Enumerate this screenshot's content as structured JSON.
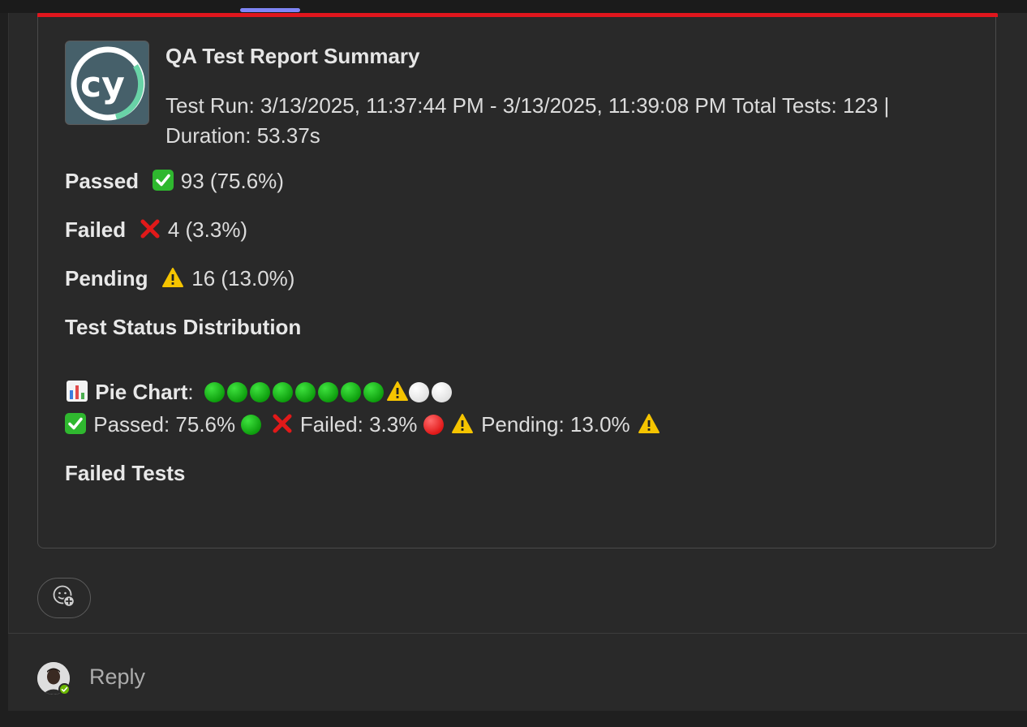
{
  "header": {
    "title": "QA Test Report Summary",
    "subtitle": "Test Run: 3/13/2025, 11:37:44 PM - 3/13/2025, 11:39:08 PM Total Tests: 123 | Duration: 53.37s"
  },
  "stats": {
    "passed": {
      "label": "Passed",
      "value": "93 (75.6%)"
    },
    "failed": {
      "label": "Failed",
      "value": "4 (3.3%)"
    },
    "pending": {
      "label": "Pending",
      "value": "16 (13.0%)"
    }
  },
  "distribution": {
    "heading": "Test Status Distribution",
    "pie_label": "Pie Chart",
    "pie_colon": ":",
    "legend": {
      "passed": "Passed: 75.6%",
      "failed": "Failed: 3.3%",
      "pending": "Pending: 13.0%"
    }
  },
  "failed_tests": {
    "heading": "Failed Tests"
  },
  "reply": {
    "label": "Reply"
  },
  "icons": {
    "logo": "cypress-logo",
    "passed": "check-mark-icon",
    "failed": "cross-mark-icon",
    "pending": "warning-icon",
    "chart": "bar-chart-icon",
    "reaction": "add-reaction-icon",
    "presence": "available-status-icon"
  },
  "colors": {
    "accent": "#e0161d",
    "passed": "#12a312",
    "failed": "#e11919",
    "pending": "#f5c400",
    "presence": "#6bb700"
  },
  "chart_data": {
    "type": "table",
    "categories": [
      "Passed",
      "Failed",
      "Pending"
    ],
    "values": [
      93,
      4,
      16
    ],
    "percentages": [
      75.6,
      3.3,
      13.0
    ],
    "total": 123
  }
}
